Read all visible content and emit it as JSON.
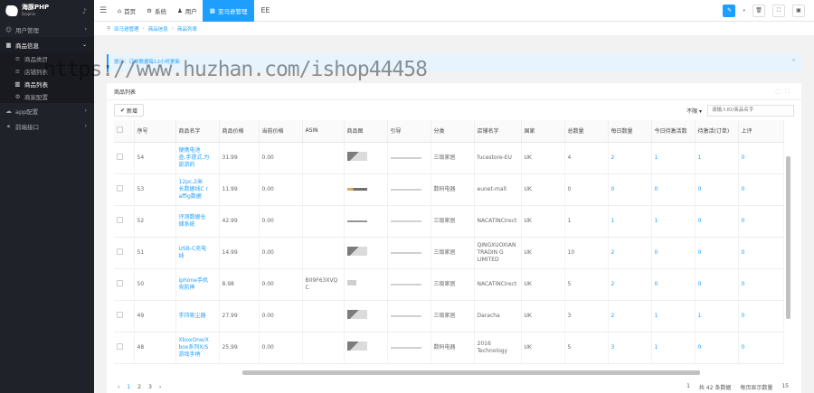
{
  "sidebar": {
    "logo_title": "海豚PHP",
    "logo_sub": "Dolphin",
    "items": [
      {
        "label": "用户管理",
        "icon": "user-icon"
      },
      {
        "label": "商品信息",
        "icon": "grid-icon"
      }
    ],
    "sub_items": [
      {
        "label": "商品类目"
      },
      {
        "label": "店铺列表"
      },
      {
        "label": "商品列表"
      },
      {
        "label": "商家配置"
      }
    ],
    "items_after": [
      {
        "label": "app配置",
        "icon": "cloud-icon"
      },
      {
        "label": "前端接口",
        "icon": "link-icon"
      }
    ]
  },
  "topbar": {
    "tabs": [
      "首页",
      "系统",
      "用户"
    ],
    "active_tab": "亚马逊管理",
    "extra": "EE"
  },
  "breadcrumb": [
    "亚马逊管理",
    "商品信息",
    "商品列表"
  ],
  "notice": "提示：订单数据每12小时更新",
  "watermark": "https://www.huzhan.com/ishop44458",
  "panel": {
    "title": "商品列表",
    "add_label": "新增",
    "filter_label": "不限",
    "search_placeholder": "请输入ID/商品名字"
  },
  "table": {
    "headers": [
      "序号",
      "商品名字",
      "商品价格",
      "当前价格",
      "ASIN",
      "商品图",
      "引导",
      "分类",
      "店铺名字",
      "国家",
      "总数量",
      "每日数量",
      "今日待激活数",
      "待激活(订单)",
      "上评"
    ],
    "rows": [
      {
        "id": "54",
        "name": "便携电池\n壶,手提式,为\n旅游的",
        "price": "31.99",
        "cur": "0.00",
        "asin": "",
        "cat": "三级家居",
        "shop": "fucestore-EU",
        "country": "UK",
        "total": "4",
        "daily": "2",
        "c1": "1",
        "c2": "1",
        "c3": "0"
      },
      {
        "id": "53",
        "name": "12pc,2米\n长数据线C r\naffig数据",
        "price": "11.99",
        "cur": "0.00",
        "asin": "",
        "cat": "数码电器",
        "shop": "eunet-mall",
        "country": "UK",
        "total": "0",
        "daily": "0",
        "c1": "0",
        "c2": "0",
        "c3": "0"
      },
      {
        "id": "52",
        "name": "评测数据仓\n储系统",
        "price": "42.99",
        "cur": "0.00",
        "asin": "",
        "cat": "三级家居",
        "shop": "NACATINCIrect",
        "country": "UK",
        "total": "1",
        "daily": "1",
        "c1": "1",
        "c2": "0",
        "c3": "0"
      },
      {
        "id": "51",
        "name": "USB-C充电\n线",
        "price": "14.99",
        "cur": "0.00",
        "asin": "",
        "cat": "三级家居",
        "shop": "QINGXUOXIAN TRADIN G LIMITED",
        "country": "UK",
        "total": "10",
        "daily": "2",
        "c1": "0",
        "c2": "0",
        "c3": "0"
      },
      {
        "id": "50",
        "name": "iphone手机\n壳防摔",
        "price": "8.98",
        "cur": "0.00",
        "asin": "B09F63XVQ\nC",
        "cat": "三级家居",
        "shop": "NACATINCIrect",
        "country": "UK",
        "total": "5",
        "daily": "2",
        "c1": "0",
        "c2": "0",
        "c3": "0"
      },
      {
        "id": "49",
        "name": "手持吸尘器",
        "price": "27.99",
        "cur": "0.00",
        "asin": "",
        "cat": "三级家居",
        "shop": "Daracha",
        "country": "UK",
        "total": "3",
        "daily": "2",
        "c1": "1",
        "c2": "1",
        "c3": "0"
      },
      {
        "id": "48",
        "name": "XboxOne/X\nbox系列X/S\n游戏手柄",
        "price": "25.99",
        "cur": "0.00",
        "asin": "",
        "cat": "数码电器",
        "shop": "2016 Technology",
        "country": "UK",
        "total": "5",
        "daily": "3",
        "c1": "1",
        "c2": "0",
        "c3": "0"
      }
    ]
  },
  "pager": {
    "prev": "‹",
    "pages": [
      "1",
      "2",
      "3"
    ],
    "next": "›",
    "goto": "1",
    "total": "共 42 条数据",
    "per_page": "每页显示数量",
    "size": "15"
  }
}
